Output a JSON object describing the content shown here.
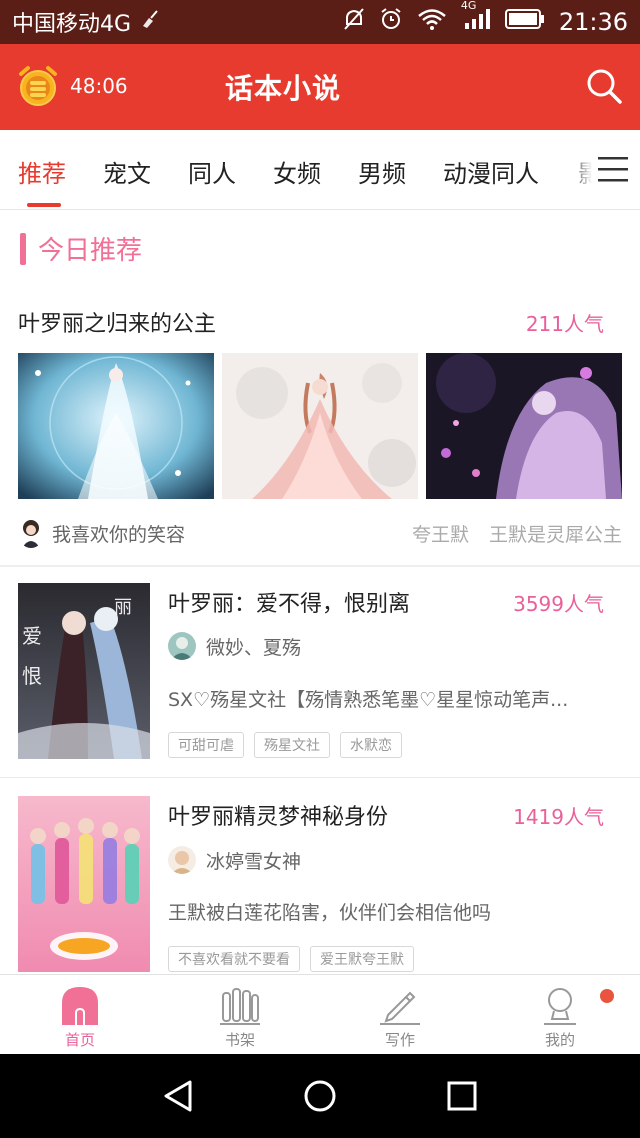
{
  "status_bar": {
    "carrier": "中国移动4G",
    "network": "4G",
    "time": "21:36"
  },
  "app_bar": {
    "timer": "48:06",
    "title": "话本小说"
  },
  "tabs": [
    "推荐",
    "宠文",
    "同人",
    "女频",
    "男频",
    "动漫同人",
    "影"
  ],
  "active_tab": "推荐",
  "section": {
    "title": "今日推荐"
  },
  "featured": {
    "title": "叶罗丽之归来的公主",
    "popularity": "211人气",
    "author": "我喜欢你的笑容",
    "tags": [
      "夸王默",
      "王默是灵犀公主"
    ]
  },
  "books": [
    {
      "title": "叶罗丽：爱不得，恨别离",
      "popularity": "3599人气",
      "author": "微妙、夏殇",
      "description": "SX♡殇星文社【殇情熟悉笔墨♡星星惊动笔声...",
      "tags": [
        "可甜可虐",
        "殇星文社",
        "水默恋"
      ]
    },
    {
      "title": "叶罗丽精灵梦神秘身份",
      "popularity": "1419人气",
      "author": "冰婷雪女神",
      "description": "王默被白莲花陷害，伙伴们会相信他吗",
      "tags": [
        "不喜欢看就不要看",
        "爱王默夸王默"
      ]
    }
  ],
  "bottom_nav": [
    {
      "label": "首页",
      "icon": "home-icon"
    },
    {
      "label": "书架",
      "icon": "bookshelf-icon"
    },
    {
      "label": "写作",
      "icon": "pen-icon"
    },
    {
      "label": "我的",
      "icon": "profile-icon"
    }
  ],
  "colors": {
    "primary_red": "#e63b2e",
    "accent_pink": "#e9609a",
    "status_bar": "#5a1e17"
  }
}
